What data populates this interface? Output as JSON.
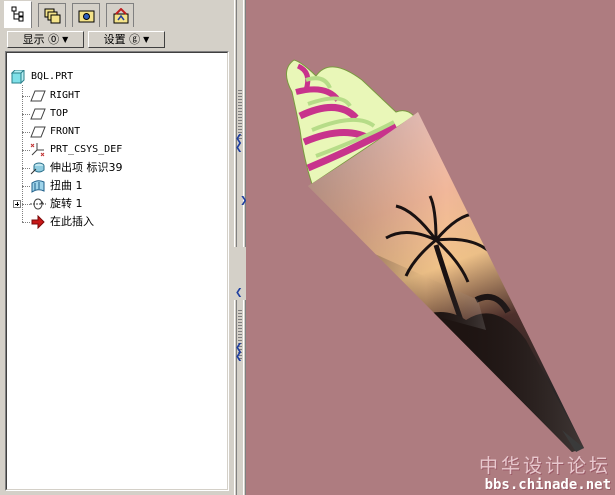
{
  "left_panel": {
    "tabs": [
      {
        "icon": "model-tree-icon",
        "active": true
      },
      {
        "icon": "layers-icon",
        "active": false
      },
      {
        "icon": "folder-browser-icon",
        "active": false
      },
      {
        "icon": "favorites-icon",
        "active": false
      }
    ],
    "toolbar": {
      "show_label": "显示 ⓪",
      "settings_label": "设置 ⓖ"
    },
    "tree": [
      {
        "label": "BQL.PRT",
        "icon": "part-icon"
      },
      {
        "label": "RIGHT",
        "icon": "datum-plane-icon"
      },
      {
        "label": "TOP",
        "icon": "datum-plane-icon"
      },
      {
        "label": "FRONT",
        "icon": "datum-plane-icon"
      },
      {
        "label": "PRT_CSYS_DEF",
        "icon": "coordinate-system-icon"
      },
      {
        "label": "伸出项 标识39",
        "icon": "protrusion-icon"
      },
      {
        "label": "扭曲 1",
        "icon": "warp-icon"
      },
      {
        "label": "旋转 1",
        "icon": "revolve-icon"
      },
      {
        "label": "在此插入",
        "icon": "insert-here-icon"
      }
    ]
  },
  "viewport": {
    "background": "#ae7c80",
    "watermark": {
      "line1": "中华设计论坛",
      "line2": "bbs.chinade.net"
    }
  }
}
